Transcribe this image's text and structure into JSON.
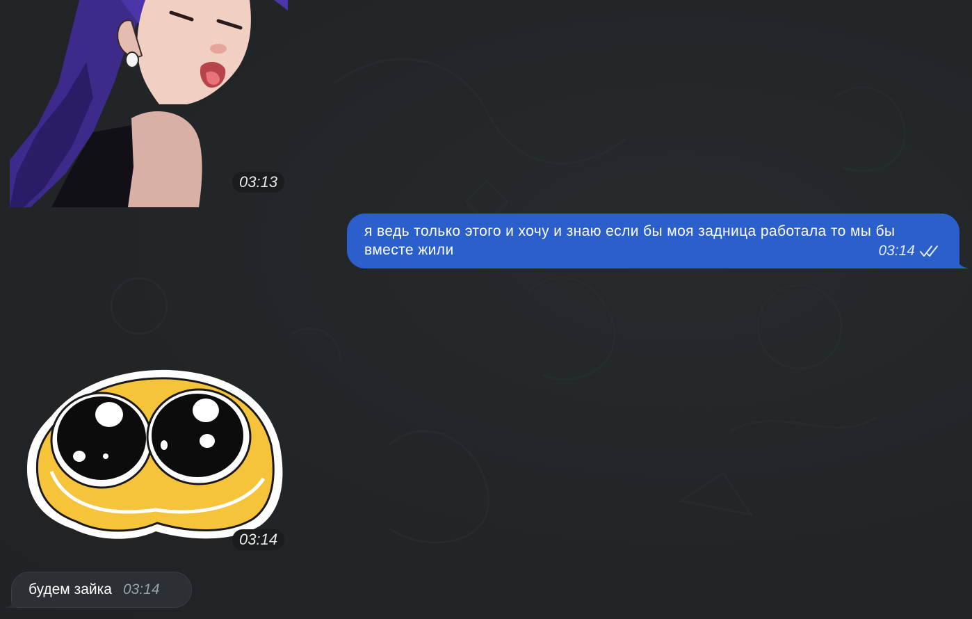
{
  "messages": [
    {
      "type": "sticker",
      "sticker_icon": "anime-girl-tongue-sticker-icon",
      "time": "03:13"
    },
    {
      "type": "text",
      "direction": "outgoing",
      "text": "я ведь только этого и хочу и знаю если бы моя задница работала то мы бы вместе жили",
      "time": "03:14",
      "status_icon": "double-check-icon"
    },
    {
      "type": "sticker",
      "sticker_icon": "cute-pleading-emoji-sticker-icon",
      "time": "03:14"
    },
    {
      "type": "text",
      "direction": "incoming",
      "text": "будем зайка",
      "time": "03:14"
    }
  ],
  "colors": {
    "background": "#232629",
    "outgoing_bubble": "#2b5fcc",
    "incoming_bubble": "#2c2f33",
    "time_pill": "#1a1c1e"
  }
}
